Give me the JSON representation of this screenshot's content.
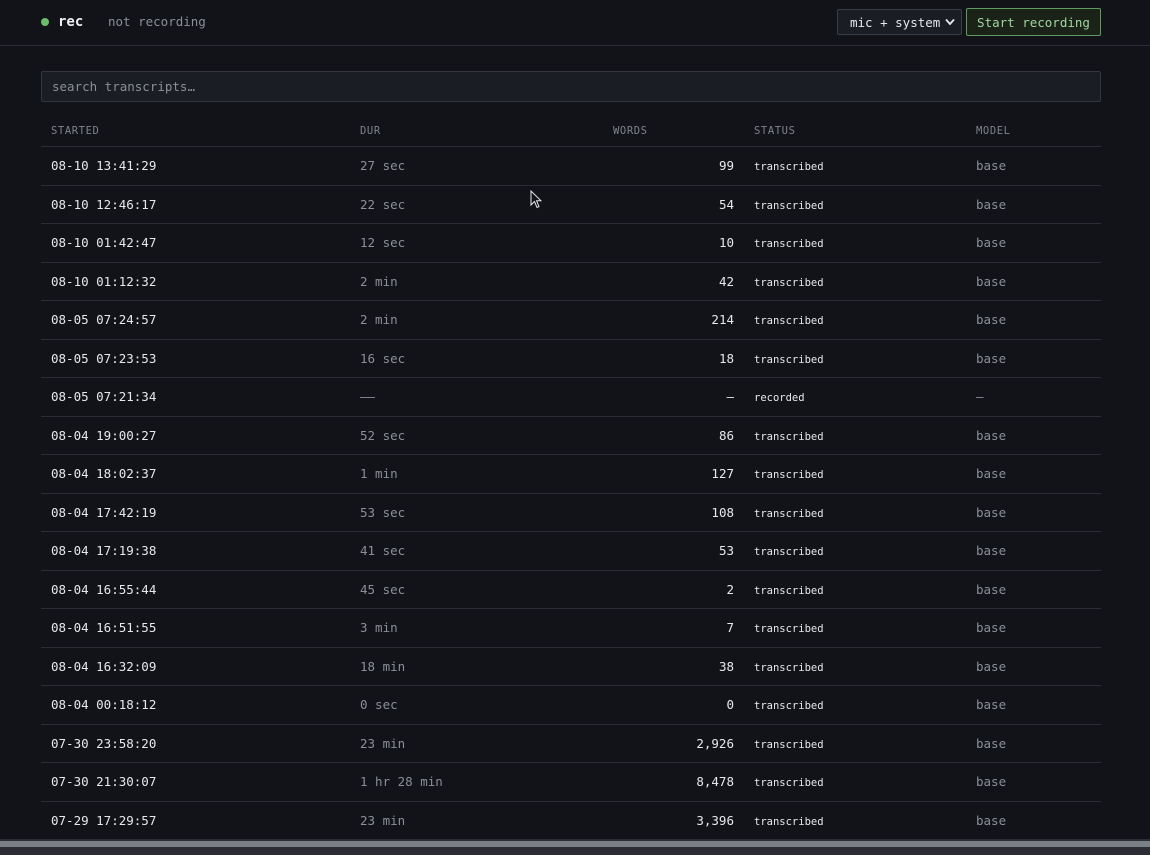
{
  "header": {
    "title": "rec",
    "status": "not recording",
    "source_select": "mic + system",
    "start_button": "Start recording"
  },
  "search": {
    "placeholder": "search transcripts…"
  },
  "table": {
    "columns": {
      "started": "STARTED",
      "dur": "DUR",
      "words": "WORDS",
      "status": "STATUS",
      "model": "MODEL"
    },
    "rows": [
      {
        "started": "08-10 13:41:29",
        "dur": "27 sec",
        "words": "99",
        "status": "transcribed",
        "model": "base"
      },
      {
        "started": "08-10 12:46:17",
        "dur": "22 sec",
        "words": "54",
        "status": "transcribed",
        "model": "base"
      },
      {
        "started": "08-10 01:42:47",
        "dur": "12 sec",
        "words": "10",
        "status": "transcribed",
        "model": "base"
      },
      {
        "started": "08-10 01:12:32",
        "dur": "2 min",
        "words": "42",
        "status": "transcribed",
        "model": "base"
      },
      {
        "started": "08-05 07:24:57",
        "dur": "2 min",
        "words": "214",
        "status": "transcribed",
        "model": "base"
      },
      {
        "started": "08-05 07:23:53",
        "dur": "16 sec",
        "words": "18",
        "status": "transcribed",
        "model": "base"
      },
      {
        "started": "08-05 07:21:34",
        "dur": "——",
        "words": "—",
        "status": "recorded",
        "model": "—"
      },
      {
        "started": "08-04 19:00:27",
        "dur": "52 sec",
        "words": "86",
        "status": "transcribed",
        "model": "base"
      },
      {
        "started": "08-04 18:02:37",
        "dur": "1 min",
        "words": "127",
        "status": "transcribed",
        "model": "base"
      },
      {
        "started": "08-04 17:42:19",
        "dur": "53 sec",
        "words": "108",
        "status": "transcribed",
        "model": "base"
      },
      {
        "started": "08-04 17:19:38",
        "dur": "41 sec",
        "words": "53",
        "status": "transcribed",
        "model": "base"
      },
      {
        "started": "08-04 16:55:44",
        "dur": "45 sec",
        "words": "2",
        "status": "transcribed",
        "model": "base"
      },
      {
        "started": "08-04 16:51:55",
        "dur": "3 min",
        "words": "7",
        "status": "transcribed",
        "model": "base"
      },
      {
        "started": "08-04 16:32:09",
        "dur": "18 min",
        "words": "38",
        "status": "transcribed",
        "model": "base"
      },
      {
        "started": "08-04 00:18:12",
        "dur": "0 sec",
        "words": "0",
        "status": "transcribed",
        "model": "base"
      },
      {
        "started": "07-30 23:58:20",
        "dur": "23 min",
        "words": "2,926",
        "status": "transcribed",
        "model": "base"
      },
      {
        "started": "07-30 21:30:07",
        "dur": "1 hr 28 min",
        "words": "8,478",
        "status": "transcribed",
        "model": "base"
      },
      {
        "started": "07-29 17:29:57",
        "dur": "23 min",
        "words": "3,396",
        "status": "transcribed",
        "model": "base"
      }
    ]
  },
  "colors": {
    "background": "#111318",
    "accent_green": "#6bbf6b",
    "border": "#2a2d34",
    "muted_text": "#8b8f97"
  },
  "icons": {
    "status_dot": "recording-status-dot",
    "select_chevron": "chevron-down-icon",
    "pointer": "mouse-cursor-icon"
  }
}
